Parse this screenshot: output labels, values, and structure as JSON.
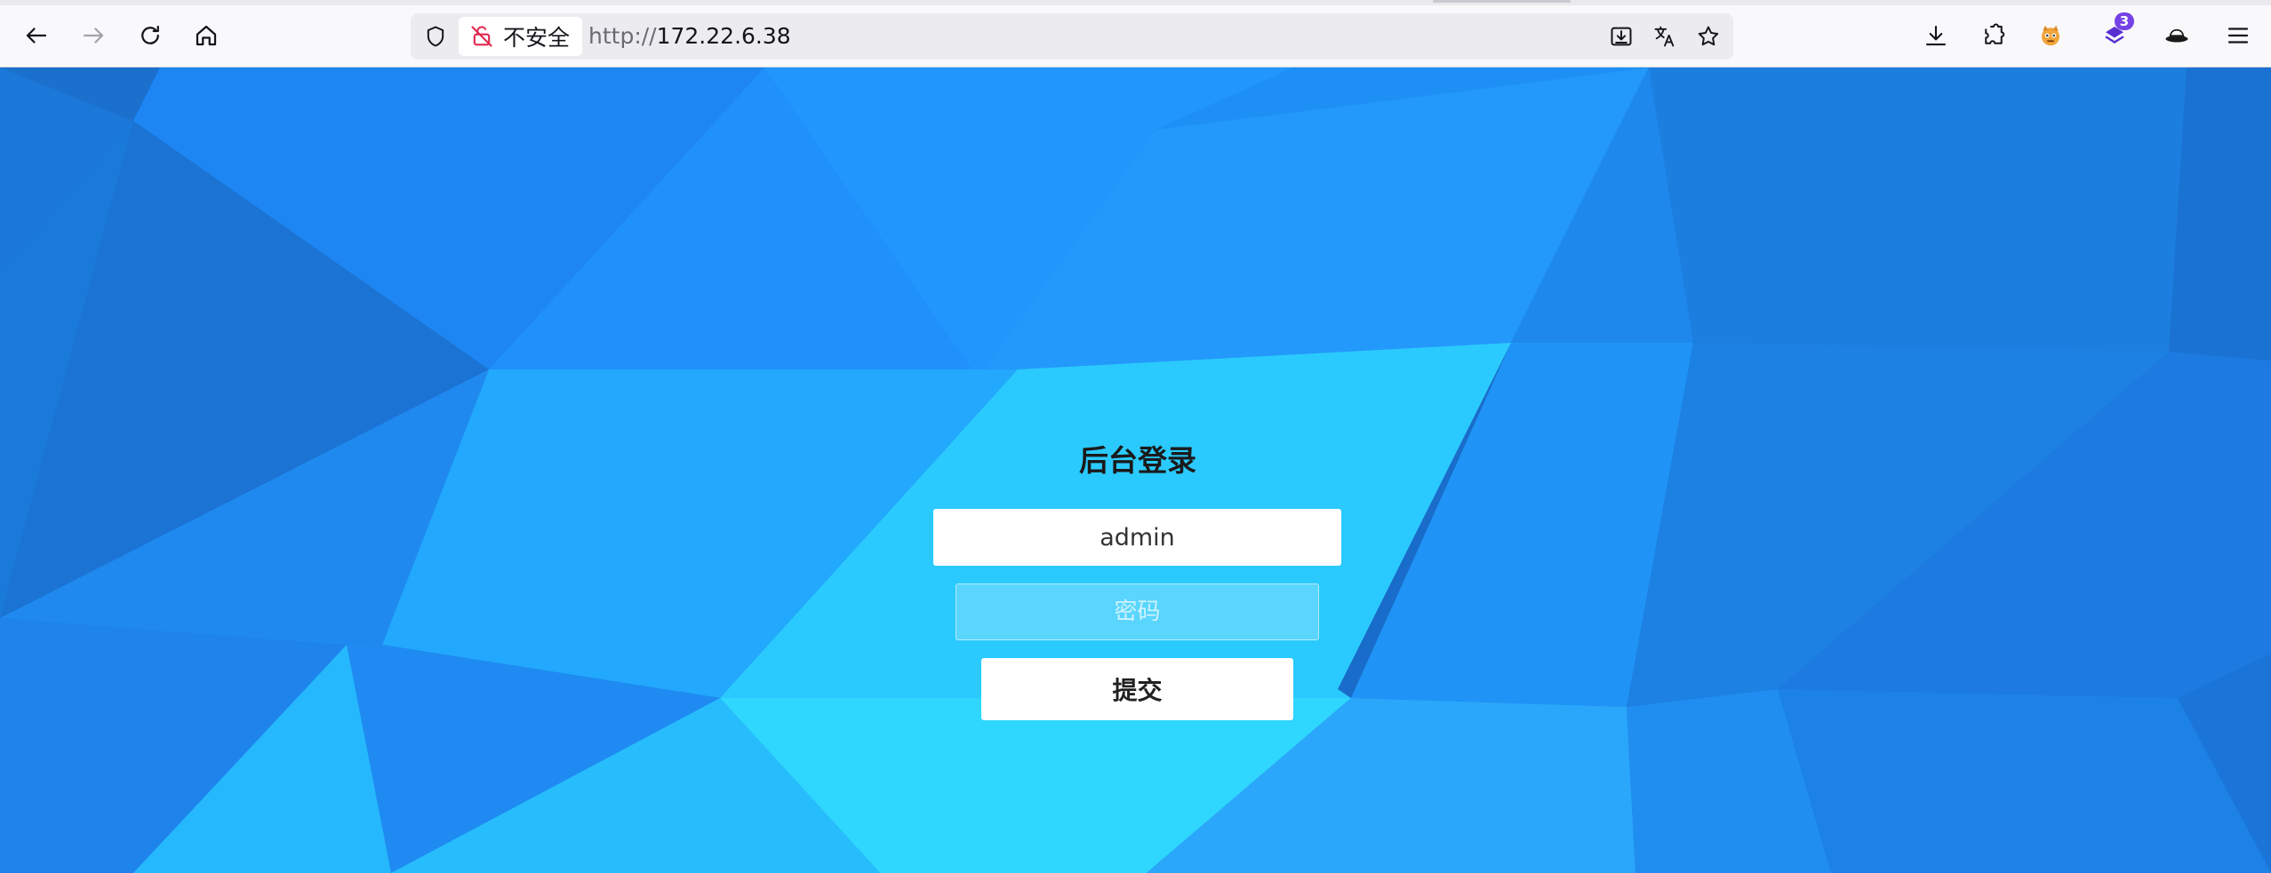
{
  "browser": {
    "nav": {
      "back_icon": "arrow-left-icon",
      "forward_icon": "arrow-right-icon",
      "reload_icon": "reload-icon",
      "home_icon": "home-icon"
    },
    "urlbar": {
      "security_label": "不安全",
      "url_scheme": "http://",
      "url_host": "172.22.6.38"
    },
    "extensions_badge": "3"
  },
  "login": {
    "title": "后台登录",
    "username_value": "admin",
    "password_placeholder": "密码",
    "submit_label": "提交"
  },
  "colors": {
    "background_blue": "#1e86f2",
    "light_cyan": "#2fd6fe",
    "badge_purple": "#7542e5"
  }
}
